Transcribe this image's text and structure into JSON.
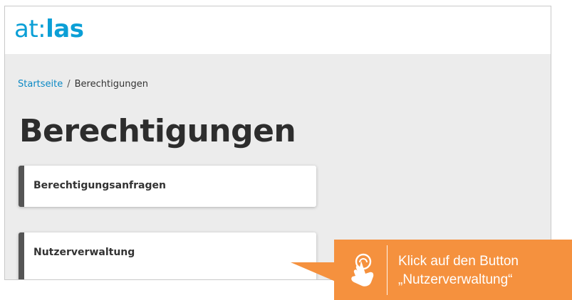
{
  "header": {
    "logo_left": "at:",
    "logo_right": "las"
  },
  "breadcrumb": {
    "home": "Startseite",
    "separator": "/",
    "current": "Berechtigungen"
  },
  "page_title": "Berechtigungen",
  "cards": [
    {
      "label": "Berechtigungsanfragen"
    },
    {
      "label": "Nutzerverwaltung"
    }
  ],
  "callout": {
    "line1": "Klick auf den Button",
    "line2": "„Nutzerverwaltung“",
    "icon": "hand-click-icon",
    "color": "#f5913e"
  },
  "colors": {
    "brand": "#0b9fd6",
    "card_accent": "#555555"
  }
}
